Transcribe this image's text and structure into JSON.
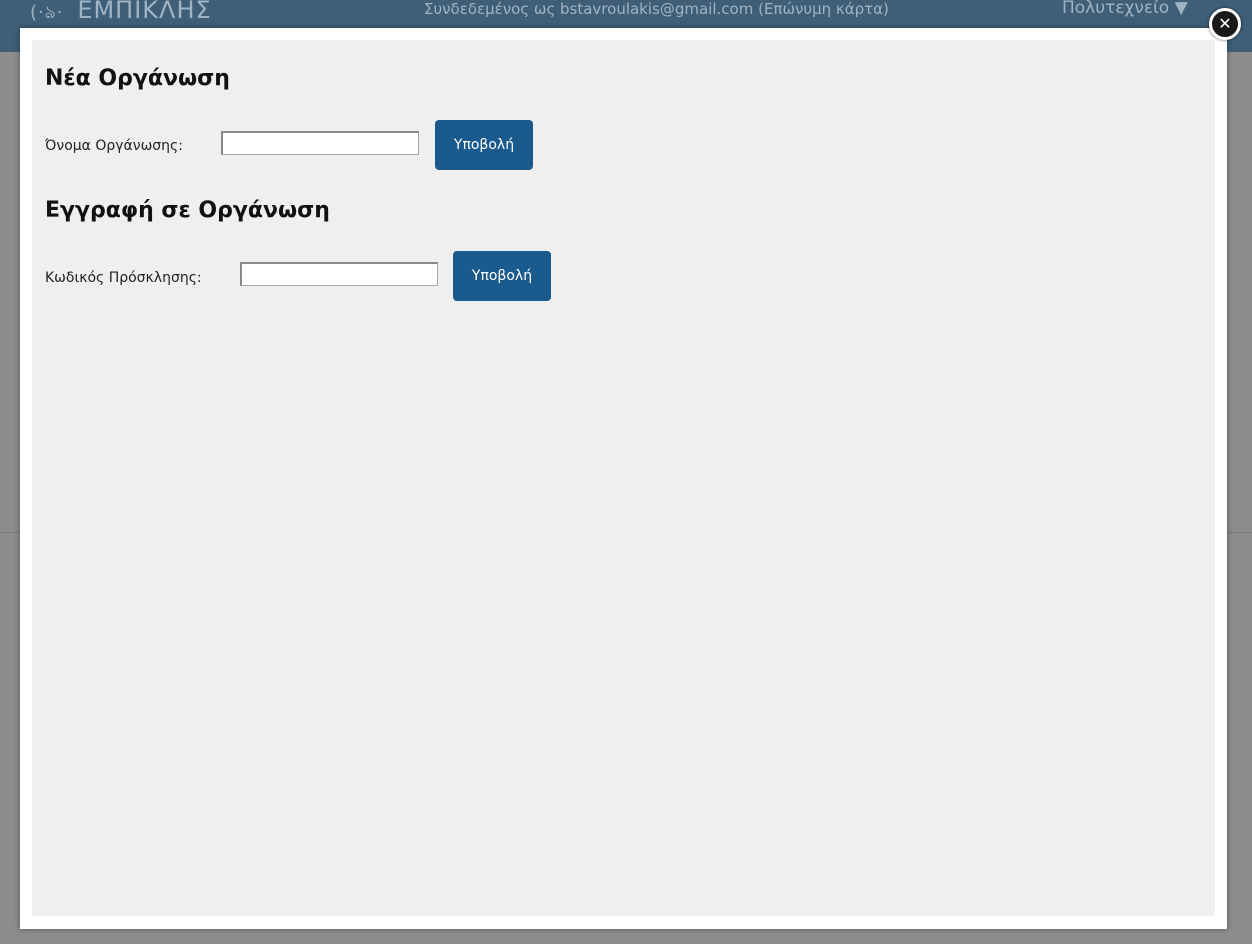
{
  "background": {
    "logo_text": "ΕΜΠΙΚΛΗΣ",
    "logo_mark": "(·ঌ·",
    "user_status": "Συνδεδεμένος ως bstavroulakis@gmail.com (Επώνυμη κάρτα)",
    "org_menu": "Πολυτεχνείο ▼"
  },
  "modal": {
    "close_glyph": "✕",
    "new_org": {
      "title": "Νέα Οργάνωση",
      "field_label": "Όνομα Οργάνωσης:",
      "field_value": "",
      "submit_label": "Υποβολή"
    },
    "join_org": {
      "title": "Εγγραφή σε Οργάνωση",
      "field_label": "Κωδικός Πρόσκλησης:",
      "field_value": "",
      "submit_label": "Υποβολή"
    }
  },
  "colors": {
    "header": "#3f5f78",
    "overlay": "#8d8d8d",
    "modal_bg": "#efefef",
    "button": "#1b5a8c"
  }
}
